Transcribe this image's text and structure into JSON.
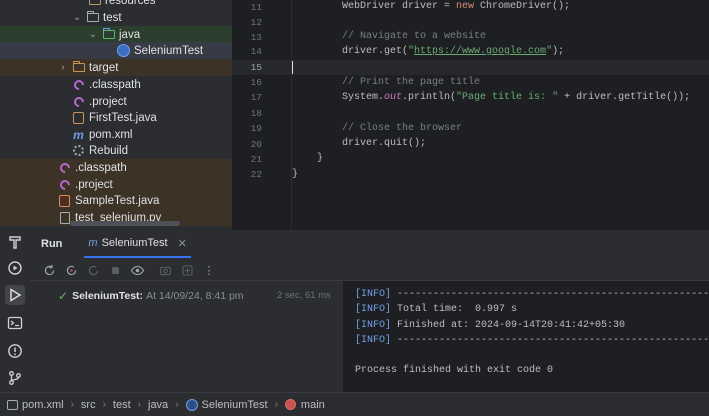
{
  "project_tree": {
    "items": [
      {
        "label": "resources",
        "icon": "folder-icon"
      },
      {
        "label": "test",
        "icon": "folder-icon"
      },
      {
        "label": "java",
        "icon": "test-source-folder-icon"
      },
      {
        "label": "SeleniumTest",
        "icon": "java-class-icon"
      },
      {
        "label": "target",
        "icon": "excluded-folder-icon"
      },
      {
        "label": ".classpath",
        "icon": "eclipse-file-icon"
      },
      {
        "label": ".project",
        "icon": "eclipse-file-icon"
      },
      {
        "label": "FirstTest.java",
        "icon": "java-file-icon"
      },
      {
        "label": "pom.xml",
        "icon": "maven-icon"
      },
      {
        "label": "Rebuild",
        "icon": "gear-icon"
      },
      {
        "label": ".classpath",
        "icon": "eclipse-file-icon"
      },
      {
        "label": ".project",
        "icon": "eclipse-file-icon"
      },
      {
        "label": "SampleTest.java",
        "icon": "java-file-icon"
      },
      {
        "label": "test_selenium.py",
        "icon": "python-file-icon"
      }
    ]
  },
  "editor": {
    "line_numbers": [
      "11",
      "12",
      "13",
      "14",
      "15",
      "16",
      "17",
      "18",
      "19",
      "20",
      "21",
      "22"
    ],
    "current_line": "15",
    "lines": {
      "l11_a": "WebDriver driver = ",
      "l11_kw": "new",
      "l11_b": " ChromeDriver();",
      "l13": "// Navigate to a website",
      "l14_a": "driver.get(",
      "l14_q1": "\"",
      "l14_url": "https://www.google.com",
      "l14_q2": "\"",
      "l14_b": ");",
      "l16": "// Print the page title",
      "l17_a": "System.",
      "l17_fld": "out",
      "l17_b": ".println(",
      "l17_str": "\"Page title is: \"",
      "l17_c": " + driver.getTitle());",
      "l19": "// Close the browser",
      "l20": "driver.quit();",
      "l21": "}",
      "l22": "}"
    }
  },
  "tool_window_bar": {
    "icons": [
      "build-icon",
      "services-icon",
      "run-icon",
      "terminal-icon",
      "problems-icon",
      "git-icon"
    ]
  },
  "run_panel": {
    "title": "Run",
    "tab_label": "SeleniumTest",
    "tab_icon": "maven-icon",
    "toolbar_icons": [
      "rerun-icon",
      "rerun-failed-icon",
      "toggle-auto-test-icon",
      "stop-icon",
      "show-passed-icon",
      "screenshot-icon",
      "export-icon",
      "more-icon"
    ],
    "test_result": {
      "name": "SeleniumTest:",
      "when": "At 14/09/24, 8:41 pm",
      "duration": "2 sec, 61 ms",
      "status": "passed"
    },
    "console_lines": [
      {
        "tag": "[INFO]",
        "text": " ------------------------------------------------------------------------"
      },
      {
        "tag": "[INFO]",
        "text": " Total time:  0.997 s"
      },
      {
        "tag": "[INFO]",
        "text": " Finished at: 2024-09-14T20:41:42+05:30"
      },
      {
        "tag": "[INFO]",
        "text": " ------------------------------------------------------------------------"
      },
      {
        "tag": "",
        "text": ""
      },
      {
        "tag": "",
        "text": "Process finished with exit code 0"
      }
    ]
  },
  "status_bar": {
    "breadcrumbs": [
      "pom.xml",
      "src",
      "test",
      "java",
      "SeleniumTest",
      "main"
    ]
  },
  "colors": {
    "accent": "#3574f0",
    "success": "#5fb865",
    "console_tag": "#6f9fe8"
  }
}
